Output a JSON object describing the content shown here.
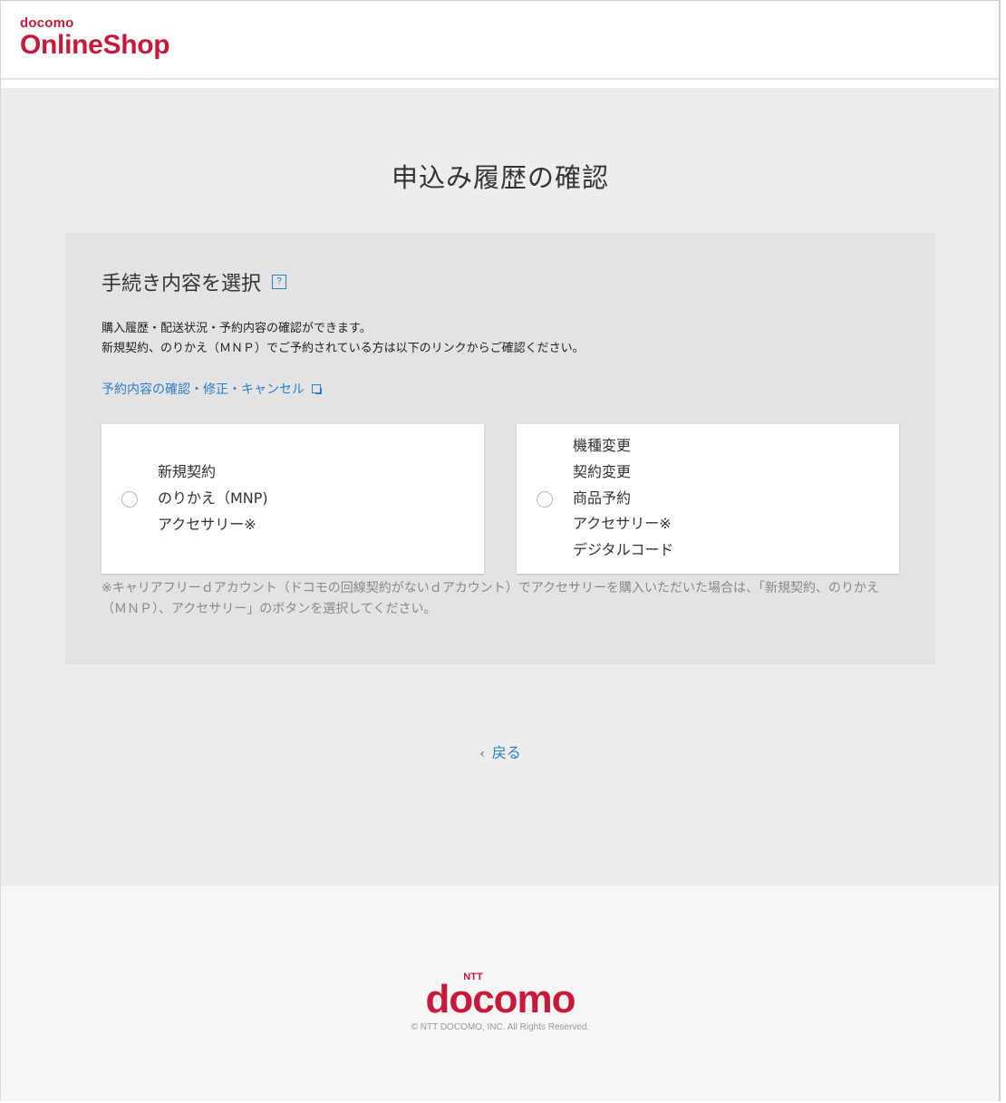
{
  "header": {
    "logo_small": "docomo",
    "logo_big": "OnlineShop"
  },
  "main": {
    "title": "申込み履歴の確認",
    "section_title": "手続き内容を選択",
    "help_icon_label": "?",
    "description": [
      "購入履歴・配送状況・予約内容の確認ができます。",
      "新規契約、のりかえ（ＭＮＰ）でご予約されている方は以下のリンクからご確認ください。"
    ],
    "reservation_link": "予約内容の確認・修正・キャンセル",
    "options": [
      {
        "lines": [
          "新規契約",
          "のりかえ（MNP)",
          "アクセサリー※"
        ]
      },
      {
        "lines": [
          "機種変更",
          "契約変更",
          "商品予約",
          "アクセサリー※",
          "デジタルコード"
        ]
      }
    ],
    "note": "※キャリアフリーｄアカウント（ドコモの回線契約がないｄアカウント）でアクセサリーを購入いただいた場合は、「新規契約、のりかえ（ＭＮＰ）、アクセサリー」のボタンを選択してください。",
    "back_chevron": "‹",
    "back_label": "戻る"
  },
  "footer": {
    "logo_ntt": "NTT",
    "logo_docomo": "docomo",
    "copyright": "© NTT DOCOMO, INC. All Rights Reserved."
  },
  "colors": {
    "brand": "#c9193b",
    "link": "#2a7dc9",
    "background": "#ededed",
    "panel": "#e3e3e3"
  }
}
